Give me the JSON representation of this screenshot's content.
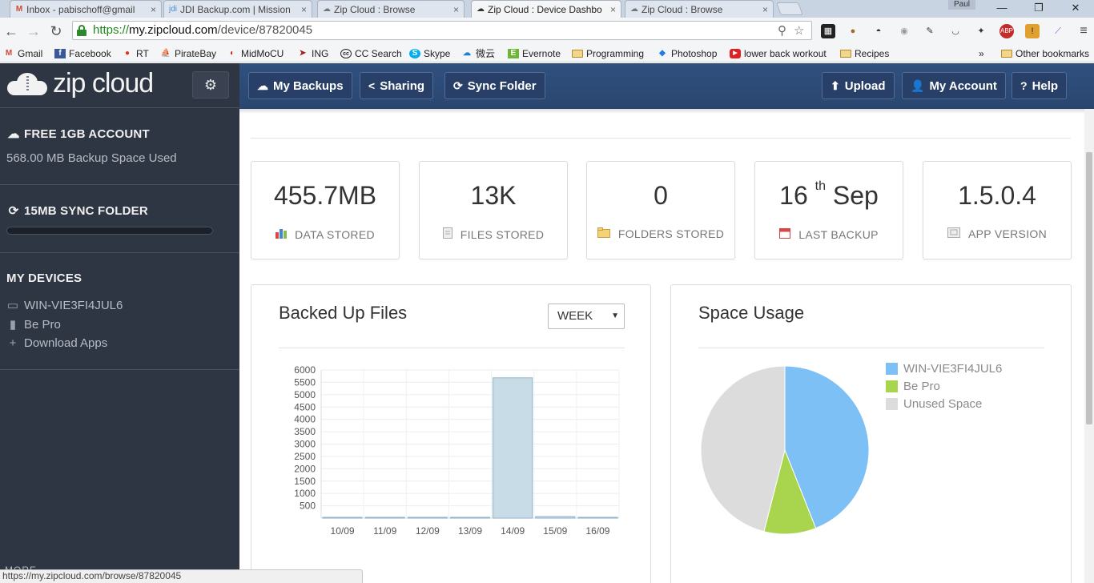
{
  "browser": {
    "tabs": [
      {
        "label": "Inbox - pabischoff@gmail",
        "icon": "gmail-icon",
        "active": false
      },
      {
        "label": "JDI Backup.com | Mission",
        "icon": "jdi-icon",
        "active": false
      },
      {
        "label": "Zip Cloud : Browse",
        "icon": "cloud-icon",
        "active": false
      },
      {
        "label": "Zip Cloud : Device Dashbo",
        "icon": "cloud-icon",
        "active": true
      },
      {
        "label": "Zip Cloud : Browse",
        "icon": "cloud-icon",
        "active": false
      }
    ],
    "user_badge": "Paul",
    "url": {
      "scheme": "https://",
      "host": "my.zipcloud.com",
      "path": "/device/87820045"
    },
    "bookmarks": [
      {
        "label": "Gmail",
        "icon": "gmail-icon"
      },
      {
        "label": "Facebook",
        "icon": "facebook-icon"
      },
      {
        "label": "RT",
        "icon": "tomato-icon"
      },
      {
        "label": "PirateBay",
        "icon": "ship-icon"
      },
      {
        "label": "MidMoCU",
        "icon": "midmo-icon"
      },
      {
        "label": "ING",
        "icon": "ing-icon"
      },
      {
        "label": "CC Search",
        "icon": "cc-icon"
      },
      {
        "label": "Skype",
        "icon": "skype-icon"
      },
      {
        "label": "微云",
        "icon": "weiyun-icon"
      },
      {
        "label": "Evernote",
        "icon": "evernote-icon"
      },
      {
        "label": "Programming",
        "icon": "folder-icon"
      },
      {
        "label": "Photoshop",
        "icon": "dropbox-icon"
      },
      {
        "label": "lower back workout",
        "icon": "youtube-icon"
      },
      {
        "label": "Recipes",
        "icon": "folder-icon"
      }
    ],
    "bookmarks_overflow": "»",
    "other_bookmarks": "Other bookmarks",
    "status_url": "https://my.zipcloud.com/browse/87820045"
  },
  "sidebar": {
    "logo_text": "zip cloud",
    "account_heading": "FREE 1GB ACCOUNT",
    "space_used": "568.00 MB Backup Space Used",
    "sync_heading": "15MB SYNC FOLDER",
    "sync_progress": 0,
    "devices_heading": "MY DEVICES",
    "devices": [
      {
        "label": "WIN-VIE3FI4JUL6",
        "icon": "monitor-icon"
      },
      {
        "label": "Be Pro",
        "icon": "android-icon"
      },
      {
        "label": "Download Apps",
        "icon": "plus-icon"
      }
    ],
    "more_label": "MORE"
  },
  "topnav": {
    "my_backups": "My Backups",
    "sharing": "Sharing",
    "sync_folder": "Sync Folder",
    "upload": "Upload",
    "my_account": "My Account",
    "help": "Help"
  },
  "stats": [
    {
      "value": "455.7MB",
      "label": "DATA STORED",
      "icon": "bar-chart-icon"
    },
    {
      "value": "13K",
      "label": "FILES STORED",
      "icon": "file-icon"
    },
    {
      "value": "0",
      "label": "FOLDERS STORED",
      "icon": "folder-icon"
    },
    {
      "value": "16",
      "sup": "th",
      "value_suffix": "Sep",
      "label": "LAST BACKUP",
      "icon": "calendar-icon"
    },
    {
      "value": "1.5.0.4",
      "label": "APP VERSION",
      "icon": "app-icon"
    }
  ],
  "backed_up_panel": {
    "title": "Backed Up Files",
    "period_select": "WEEK"
  },
  "space_panel": {
    "title": "Space Usage"
  },
  "colors": {
    "bar_fill": "#c8dce8",
    "bar_stroke": "#8fb2c8",
    "pie_device": "#7cc0f5",
    "pie_bepro": "#a8d44e",
    "pie_unused": "#dcdcdc"
  },
  "chart_data": [
    {
      "type": "bar",
      "categories": [
        "10/09",
        "11/09",
        "12/09",
        "13/09",
        "14/09",
        "15/09",
        "16/09"
      ],
      "values": [
        0,
        0,
        0,
        0,
        5650,
        30,
        0
      ],
      "ylim": [
        0,
        6000
      ],
      "yticks": [
        500,
        1000,
        1500,
        2000,
        2500,
        3000,
        3500,
        4000,
        4500,
        5000,
        5500,
        6000
      ],
      "grid": true
    },
    {
      "type": "pie",
      "labels": [
        "WIN-VIE3FI4JUL6",
        "Be Pro",
        "Unused Space"
      ],
      "values": [
        44,
        10,
        46
      ],
      "legend": "right"
    }
  ]
}
